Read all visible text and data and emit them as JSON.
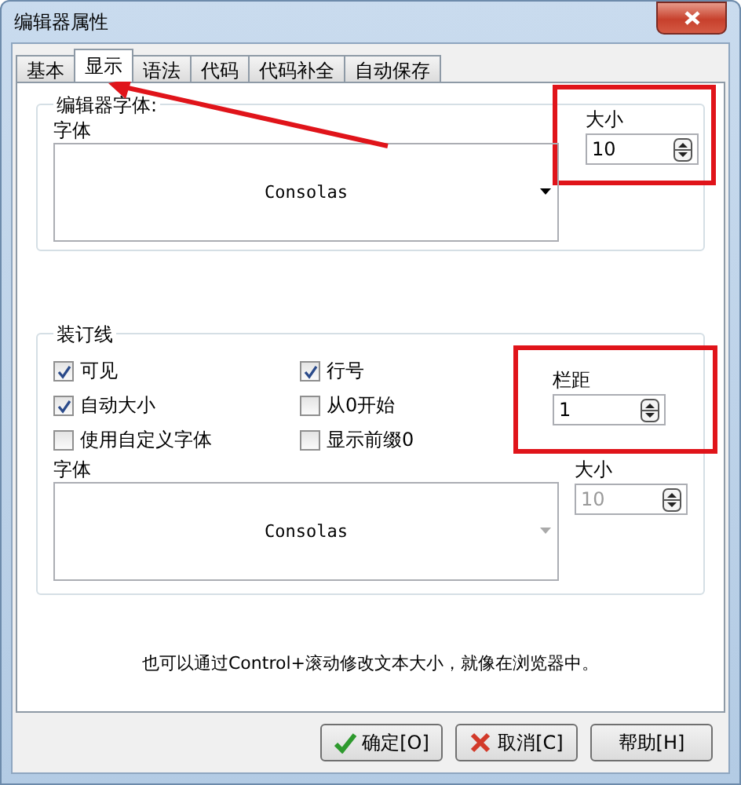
{
  "window": {
    "title": "编辑器属性"
  },
  "tabs": [
    {
      "label": "基本",
      "selected": false,
      "arrow": false
    },
    {
      "label": "显示",
      "selected": true,
      "arrow": true
    },
    {
      "label": "语法",
      "selected": false,
      "arrow": false
    },
    {
      "label": "代码",
      "selected": false,
      "arrow": false
    },
    {
      "label": "代码补全",
      "selected": false,
      "arrow": false
    },
    {
      "label": "自动保存",
      "selected": false,
      "arrow": false
    }
  ],
  "editor_font": {
    "title": "编辑器字体:",
    "font_label": "字体",
    "font_value": "Consolas",
    "size": {
      "label": "大小",
      "value": "10",
      "disabled": false,
      "highlighted": true
    }
  },
  "gutter": {
    "title": "装订线",
    "options": [
      {
        "label": "可见",
        "checked": true
      },
      {
        "label": "行号",
        "checked": true
      },
      {
        "label": "自动大小",
        "checked": true
      },
      {
        "label": "从0开始",
        "checked": false
      },
      {
        "label": "使用自定义字体",
        "checked": false
      },
      {
        "label": "显示前缀0",
        "checked": false
      }
    ],
    "spacing": {
      "label": "栏距",
      "value": "1",
      "disabled": false,
      "highlighted": true
    },
    "font_label": "字体",
    "font_value": "Consolas",
    "font_disabled": true,
    "size": {
      "label": "大小",
      "value": "10",
      "disabled": true
    }
  },
  "hint": "也可以通过Control+滚动修改文本大小，就像在浏览器中。",
  "buttons": [
    {
      "label": "确定[O]",
      "kind": "ok"
    },
    {
      "label": "取消[C]",
      "kind": "cancel"
    },
    {
      "label": "帮助[H]",
      "kind": "help"
    }
  ]
}
